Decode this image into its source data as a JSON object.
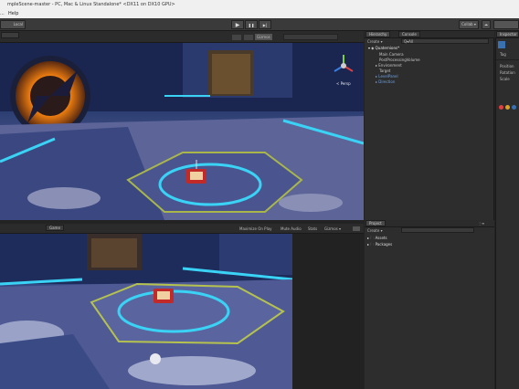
{
  "window": {
    "title": "mpleScene-master - PC, Mac & Linux Standalone* <DX11 on DX10 GPU>"
  },
  "menu": {
    "partial_item": "...",
    "help": "Help"
  },
  "toolbar": {
    "pivot_label": "Local",
    "play": "▶",
    "pause": "❚❚",
    "step": "▶|",
    "collab": "Collab ▾"
  },
  "scene_panel": {
    "toolbar_labels": [
      "Gizmos",
      "Persp"
    ],
    "persp_label": "< Persp"
  },
  "game_panel": {
    "tab": "Game",
    "options": [
      "Maximize On Play",
      "Mute Audio",
      "Stats",
      "Gizmos ▾"
    ]
  },
  "hierarchy": {
    "tab": "Hierarchy",
    "create": "Create ▾",
    "search_placeholder": "Q▾All",
    "scene": "Quaternions*",
    "items": [
      "Main Camera",
      "PostProcessingVolume",
      "Environment",
      "Target",
      "LevelPanel",
      "Direction"
    ]
  },
  "console": {
    "tab": "Console"
  },
  "project": {
    "tab": "Project",
    "create": "Create ▾",
    "folders": [
      "Assets",
      "Packages"
    ]
  },
  "inspector": {
    "tab": "Inspector",
    "labels": [
      "Tag",
      "Position",
      "Rotation",
      "Scale"
    ]
  },
  "colors": {
    "accent_cyan": "#3ad3f5",
    "panel_bg": "#2b2b2b",
    "toolbar_bg": "#3a3a3a",
    "selection_blue": "#3a72b0"
  }
}
